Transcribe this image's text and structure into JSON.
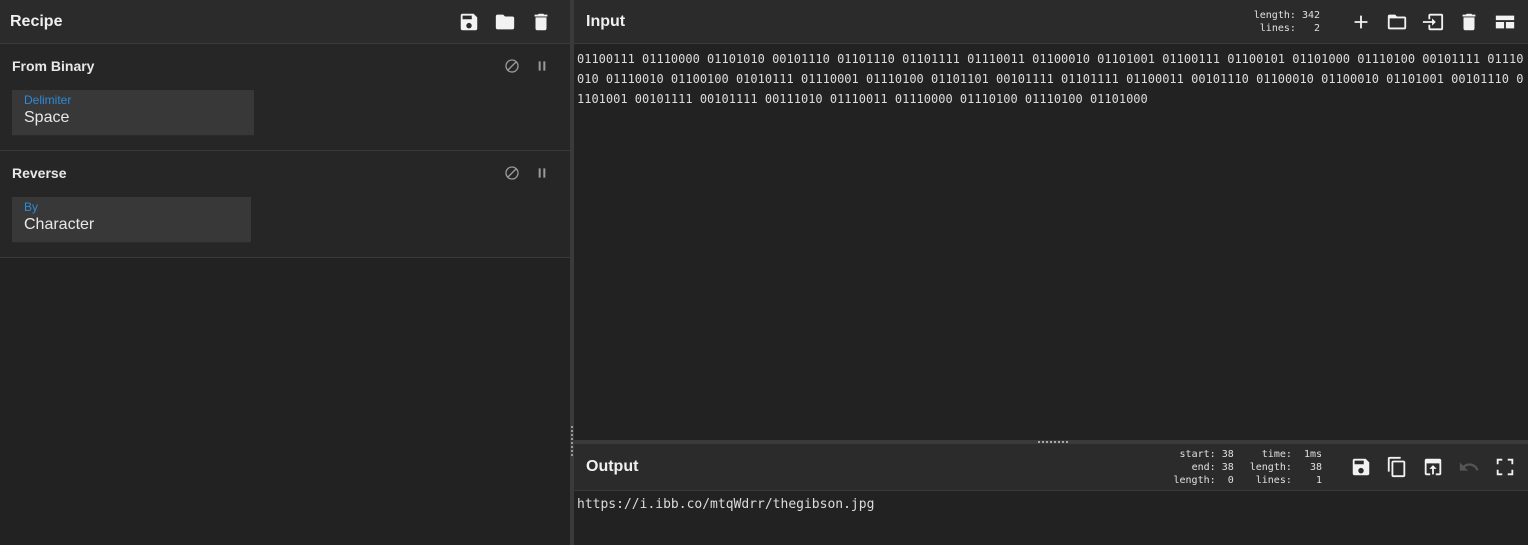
{
  "recipe": {
    "title": "Recipe",
    "operations": [
      {
        "name": "From Binary",
        "arg_label": "Delimiter",
        "arg_value": "Space"
      },
      {
        "name": "Reverse",
        "arg_label": "By",
        "arg_value": "Character"
      }
    ]
  },
  "input": {
    "title": "Input",
    "stats": {
      "length_label": "length:",
      "length": "342",
      "lines_label": "lines:",
      "lines": "2"
    },
    "text": "01100111 01110000 01101010 00101110 01101110 01101111 01110011 01100010 01101001 01100111 01100101 01101000 01110100 00101111 01110010 01110010 01100100 01010111 01110001 01110100 01101101 00101111 01101111 01100011 00101110 01100010 01100010 01101001 00101110 01101001 00101111 00101111 00111010 01110011 01110000 01110100 01110100 01101000"
  },
  "output": {
    "title": "Output",
    "stats": {
      "start_label": "start:",
      "start": "38",
      "end_label": "end:",
      "end": "38",
      "length_label": "length:",
      "sel_length": "0",
      "time_label": "time:",
      "time": "1ms",
      "out_length_label": "length:",
      "out_length": "38",
      "lines_label": "lines:",
      "lines": "1"
    },
    "text": "https://i.ibb.co/mtqWdrr/thegibson.jpg"
  },
  "icons": {
    "save": "save-icon",
    "open": "folder-icon",
    "clear": "trash-icon",
    "add": "plus-icon",
    "import": "import-icon",
    "layout": "layout-icon",
    "copy": "copy-icon",
    "replace": "replace-input-icon",
    "undo": "undo-icon",
    "maximize": "maximize-icon",
    "disable": "disable-icon",
    "pause": "pause-icon"
  }
}
